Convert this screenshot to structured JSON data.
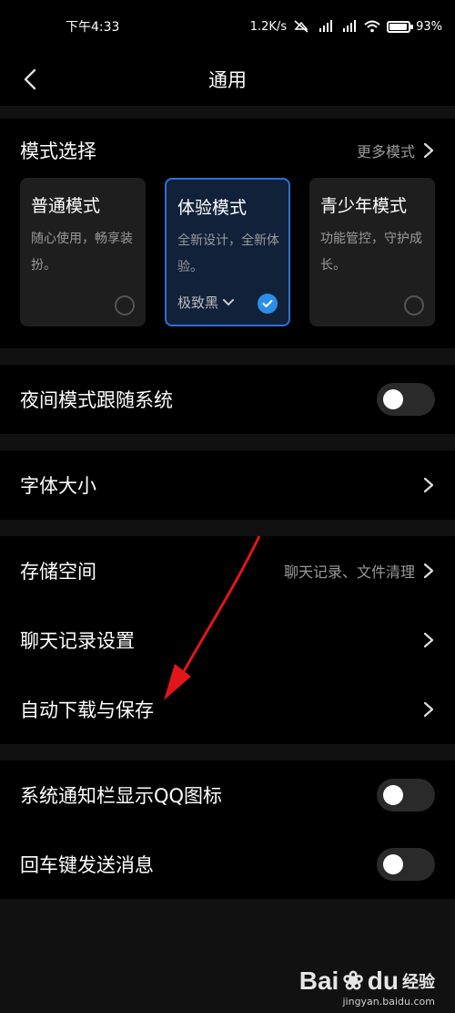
{
  "status_bar": {
    "time": "下午4:33",
    "net_speed": "1.2K/s",
    "battery": "93",
    "battery_suffix": "%",
    "battery_level": 0.93
  },
  "nav": {
    "title": "通用",
    "back_icon": "back-arrow-icon"
  },
  "mode_section": {
    "label": "模式选择",
    "more": "更多模式",
    "cards": [
      {
        "title": "普通模式",
        "desc": "随心使用，畅享装扮。",
        "selected": false
      },
      {
        "title": "体验模式",
        "desc": "全新设计，全新体验。",
        "selected": true,
        "theme": "极致黑"
      },
      {
        "title": "青少年模式",
        "desc": "功能管控，守护成长。",
        "selected": false
      }
    ]
  },
  "night_mode": {
    "label": "夜间模式跟随系统",
    "on": false
  },
  "font_size": {
    "label": "字体大小"
  },
  "storage": {
    "label": "存储空间",
    "sub": "聊天记录、文件清理"
  },
  "chat_settings": {
    "label": "聊天记录设置"
  },
  "auto_download": {
    "label": "自动下载与保存"
  },
  "notify_icon": {
    "label": "系统通知栏显示QQ图标",
    "on": false
  },
  "enter_send": {
    "label": "回车键发送消息",
    "on": false
  },
  "watermark": {
    "logo": "Bai",
    "logo2": "du",
    "logo3": "经验",
    "url": "jingyan.baidu.com"
  },
  "colors": {
    "accent": "#2b8fe9",
    "background": "#000000",
    "arrow": "#e0161b"
  }
}
